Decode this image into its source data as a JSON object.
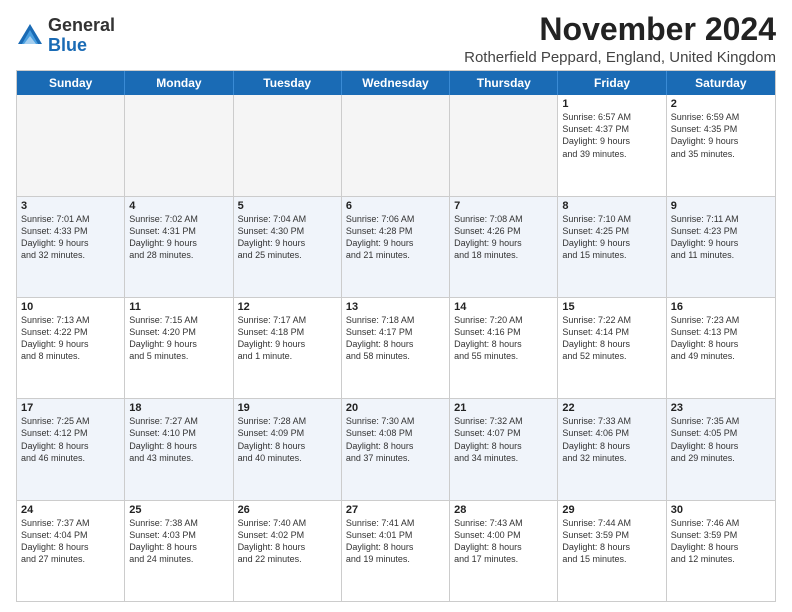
{
  "logo": {
    "general": "General",
    "blue": "Blue"
  },
  "title": "November 2024",
  "location": "Rotherfield Peppard, England, United Kingdom",
  "header_days": [
    "Sunday",
    "Monday",
    "Tuesday",
    "Wednesday",
    "Thursday",
    "Friday",
    "Saturday"
  ],
  "rows": [
    [
      {
        "day": "",
        "info": ""
      },
      {
        "day": "",
        "info": ""
      },
      {
        "day": "",
        "info": ""
      },
      {
        "day": "",
        "info": ""
      },
      {
        "day": "",
        "info": ""
      },
      {
        "day": "1",
        "info": "Sunrise: 6:57 AM\nSunset: 4:37 PM\nDaylight: 9 hours\nand 39 minutes."
      },
      {
        "day": "2",
        "info": "Sunrise: 6:59 AM\nSunset: 4:35 PM\nDaylight: 9 hours\nand 35 minutes."
      }
    ],
    [
      {
        "day": "3",
        "info": "Sunrise: 7:01 AM\nSunset: 4:33 PM\nDaylight: 9 hours\nand 32 minutes."
      },
      {
        "day": "4",
        "info": "Sunrise: 7:02 AM\nSunset: 4:31 PM\nDaylight: 9 hours\nand 28 minutes."
      },
      {
        "day": "5",
        "info": "Sunrise: 7:04 AM\nSunset: 4:30 PM\nDaylight: 9 hours\nand 25 minutes."
      },
      {
        "day": "6",
        "info": "Sunrise: 7:06 AM\nSunset: 4:28 PM\nDaylight: 9 hours\nand 21 minutes."
      },
      {
        "day": "7",
        "info": "Sunrise: 7:08 AM\nSunset: 4:26 PM\nDaylight: 9 hours\nand 18 minutes."
      },
      {
        "day": "8",
        "info": "Sunrise: 7:10 AM\nSunset: 4:25 PM\nDaylight: 9 hours\nand 15 minutes."
      },
      {
        "day": "9",
        "info": "Sunrise: 7:11 AM\nSunset: 4:23 PM\nDaylight: 9 hours\nand 11 minutes."
      }
    ],
    [
      {
        "day": "10",
        "info": "Sunrise: 7:13 AM\nSunset: 4:22 PM\nDaylight: 9 hours\nand 8 minutes."
      },
      {
        "day": "11",
        "info": "Sunrise: 7:15 AM\nSunset: 4:20 PM\nDaylight: 9 hours\nand 5 minutes."
      },
      {
        "day": "12",
        "info": "Sunrise: 7:17 AM\nSunset: 4:18 PM\nDaylight: 9 hours\nand 1 minute."
      },
      {
        "day": "13",
        "info": "Sunrise: 7:18 AM\nSunset: 4:17 PM\nDaylight: 8 hours\nand 58 minutes."
      },
      {
        "day": "14",
        "info": "Sunrise: 7:20 AM\nSunset: 4:16 PM\nDaylight: 8 hours\nand 55 minutes."
      },
      {
        "day": "15",
        "info": "Sunrise: 7:22 AM\nSunset: 4:14 PM\nDaylight: 8 hours\nand 52 minutes."
      },
      {
        "day": "16",
        "info": "Sunrise: 7:23 AM\nSunset: 4:13 PM\nDaylight: 8 hours\nand 49 minutes."
      }
    ],
    [
      {
        "day": "17",
        "info": "Sunrise: 7:25 AM\nSunset: 4:12 PM\nDaylight: 8 hours\nand 46 minutes."
      },
      {
        "day": "18",
        "info": "Sunrise: 7:27 AM\nSunset: 4:10 PM\nDaylight: 8 hours\nand 43 minutes."
      },
      {
        "day": "19",
        "info": "Sunrise: 7:28 AM\nSunset: 4:09 PM\nDaylight: 8 hours\nand 40 minutes."
      },
      {
        "day": "20",
        "info": "Sunrise: 7:30 AM\nSunset: 4:08 PM\nDaylight: 8 hours\nand 37 minutes."
      },
      {
        "day": "21",
        "info": "Sunrise: 7:32 AM\nSunset: 4:07 PM\nDaylight: 8 hours\nand 34 minutes."
      },
      {
        "day": "22",
        "info": "Sunrise: 7:33 AM\nSunset: 4:06 PM\nDaylight: 8 hours\nand 32 minutes."
      },
      {
        "day": "23",
        "info": "Sunrise: 7:35 AM\nSunset: 4:05 PM\nDaylight: 8 hours\nand 29 minutes."
      }
    ],
    [
      {
        "day": "24",
        "info": "Sunrise: 7:37 AM\nSunset: 4:04 PM\nDaylight: 8 hours\nand 27 minutes."
      },
      {
        "day": "25",
        "info": "Sunrise: 7:38 AM\nSunset: 4:03 PM\nDaylight: 8 hours\nand 24 minutes."
      },
      {
        "day": "26",
        "info": "Sunrise: 7:40 AM\nSunset: 4:02 PM\nDaylight: 8 hours\nand 22 minutes."
      },
      {
        "day": "27",
        "info": "Sunrise: 7:41 AM\nSunset: 4:01 PM\nDaylight: 8 hours\nand 19 minutes."
      },
      {
        "day": "28",
        "info": "Sunrise: 7:43 AM\nSunset: 4:00 PM\nDaylight: 8 hours\nand 17 minutes."
      },
      {
        "day": "29",
        "info": "Sunrise: 7:44 AM\nSunset: 3:59 PM\nDaylight: 8 hours\nand 15 minutes."
      },
      {
        "day": "30",
        "info": "Sunrise: 7:46 AM\nSunset: 3:59 PM\nDaylight: 8 hours\nand 12 minutes."
      }
    ]
  ]
}
